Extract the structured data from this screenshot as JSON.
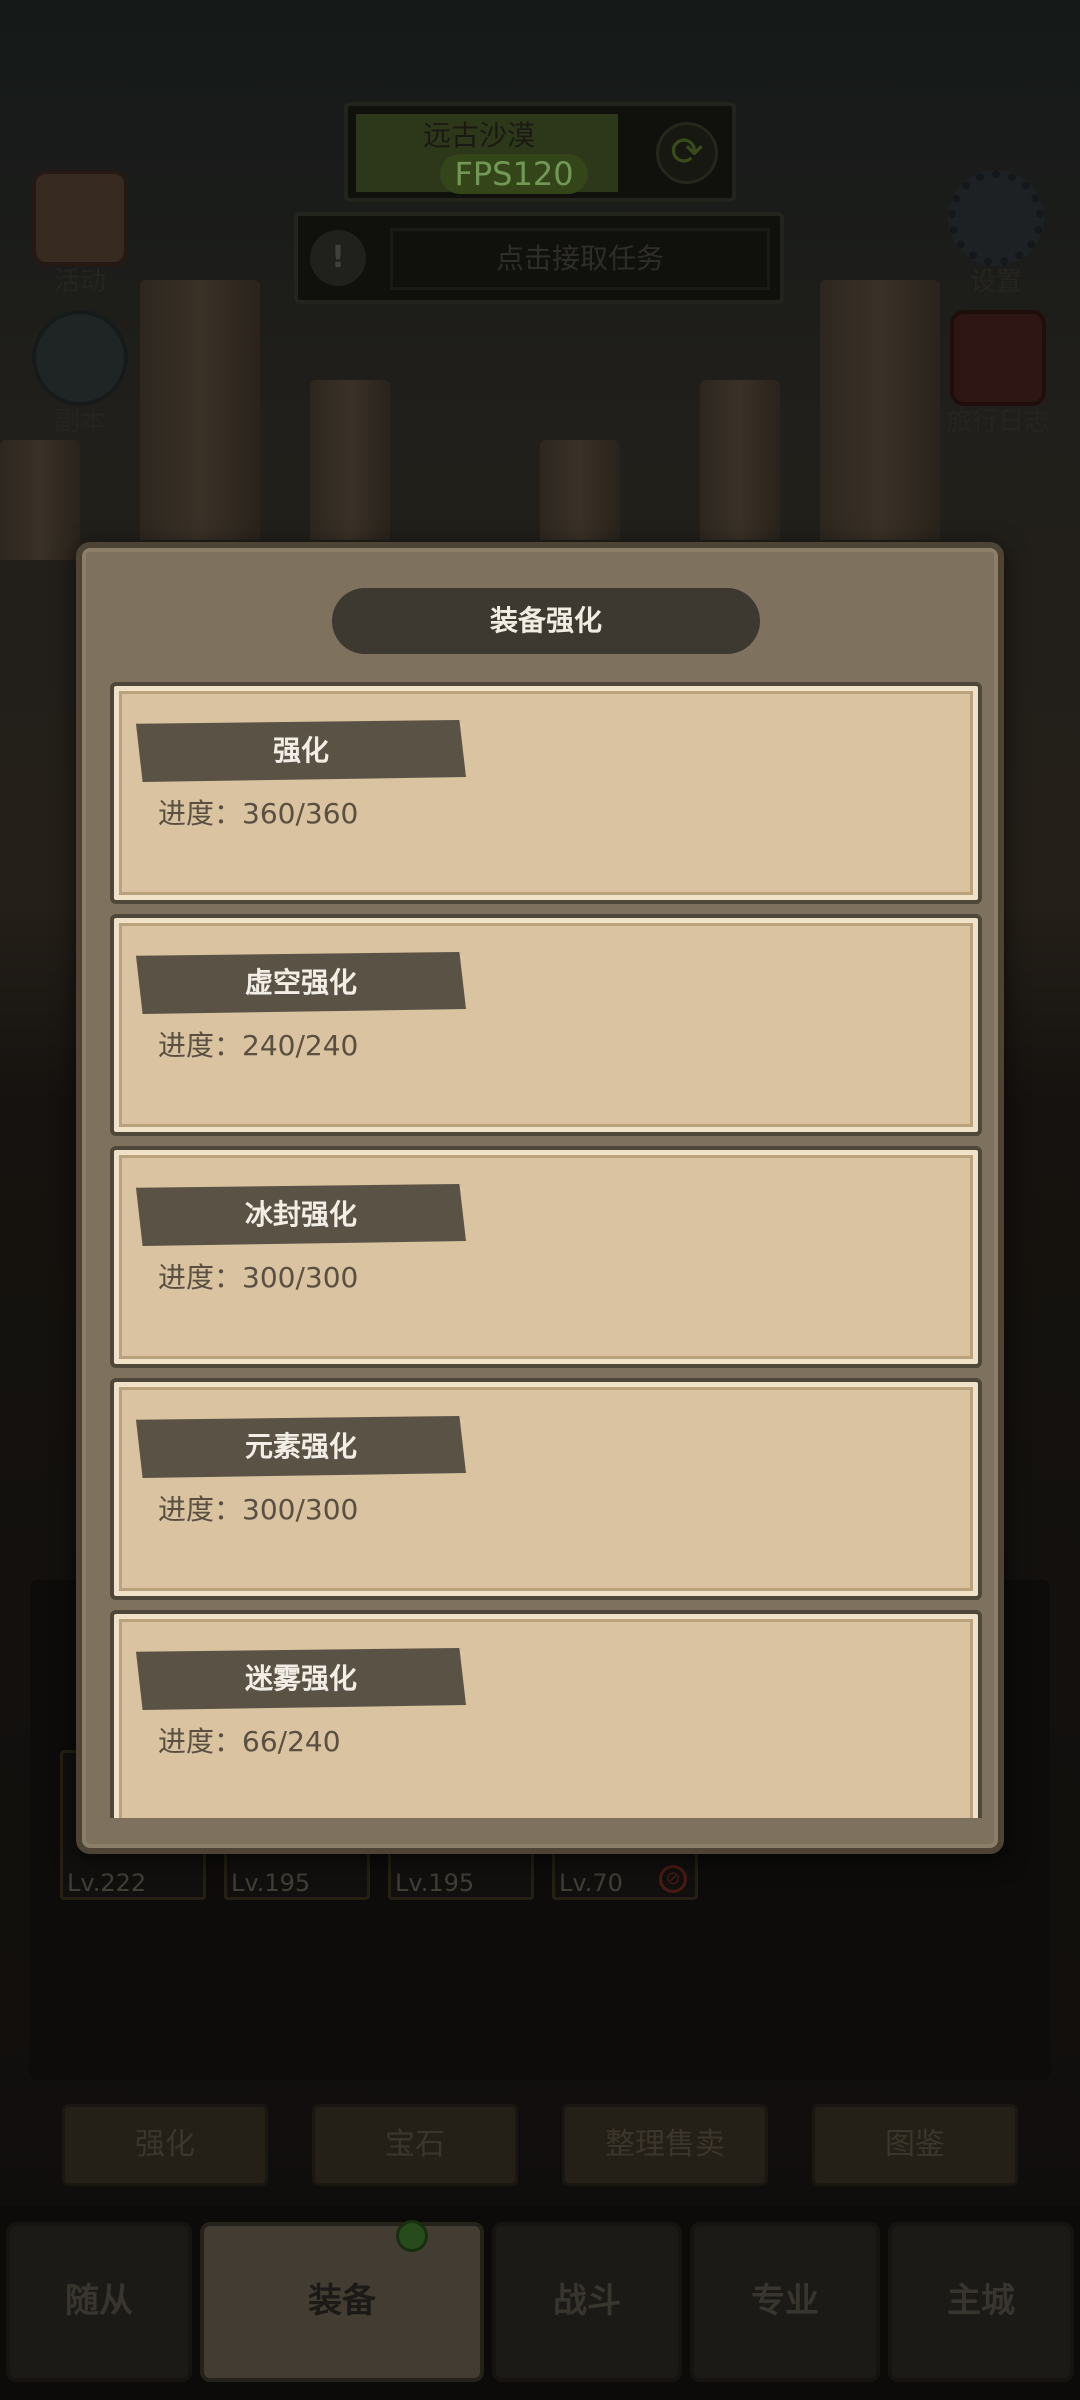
{
  "hud": {
    "zone_name": "远古沙漠",
    "fps": "FPS120",
    "quest_text": "点击接取任务"
  },
  "side_icons": {
    "activity": "活动",
    "dungeon": "副本",
    "settings": "设置",
    "journal": "旅行日志"
  },
  "modal": {
    "title": "装备强化",
    "progress_label": "进度：",
    "items": [
      {
        "name": "强化",
        "progress": "进度：360/360"
      },
      {
        "name": "虚空强化",
        "progress": "进度：240/240"
      },
      {
        "name": "冰封强化",
        "progress": "进度：300/300"
      },
      {
        "name": "元素强化",
        "progress": "进度：300/300"
      },
      {
        "name": "迷雾强化",
        "progress": "进度：66/240"
      }
    ]
  },
  "inventory": {
    "slots": [
      {
        "level": "Lv.222"
      },
      {
        "level": "Lv.195"
      },
      {
        "level": "Lv.195"
      },
      {
        "level": "Lv.70",
        "banned": true
      }
    ]
  },
  "actions": {
    "enhance": "强化",
    "gem": "宝石",
    "sort_sell": "整理售卖",
    "codex": "图鉴"
  },
  "navbar": {
    "followers": "随从",
    "equipment": "装备",
    "battle": "战斗",
    "profession": "专业",
    "main_city": "主城"
  },
  "colors": {
    "modal_bg": "#7e715d",
    "card_bg": "#d9c3a0",
    "tag_bg": "#5a5245",
    "fps_text": "#b8f58a"
  }
}
